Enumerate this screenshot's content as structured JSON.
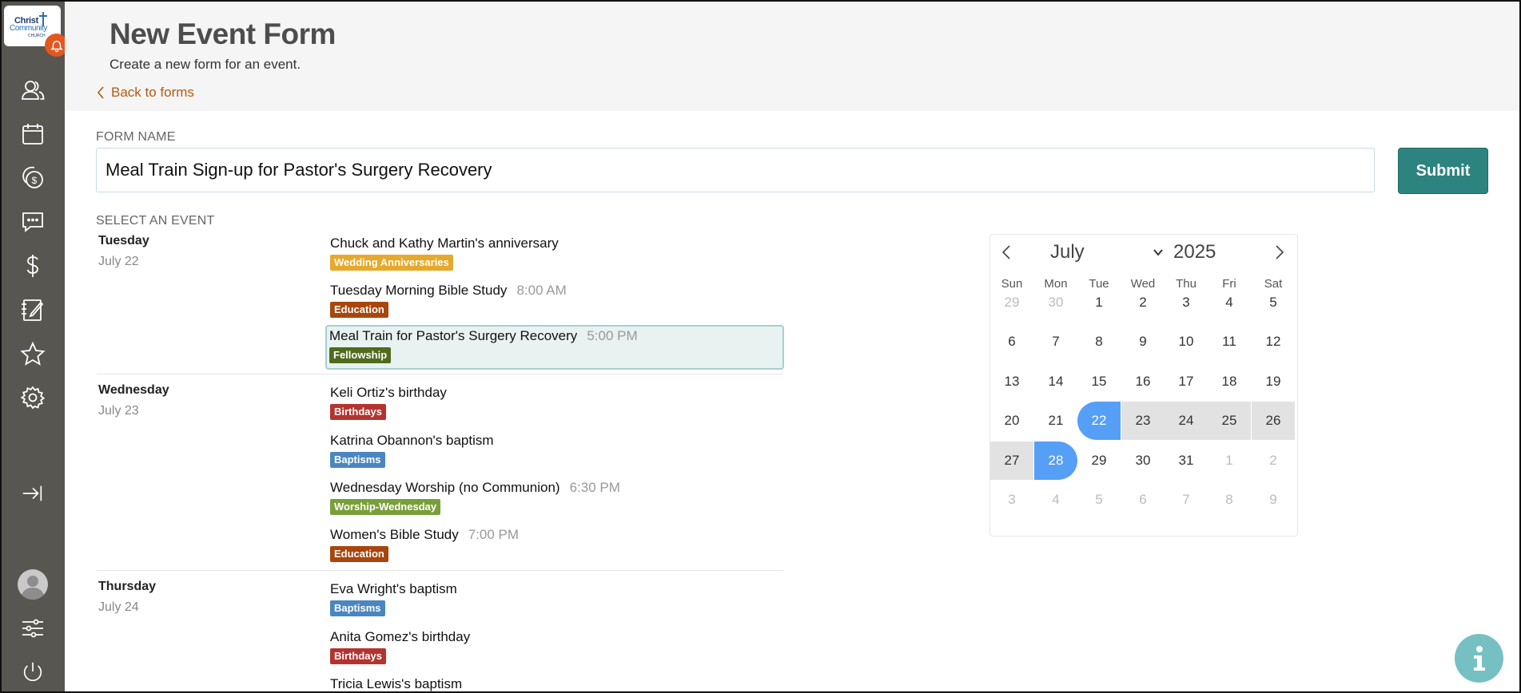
{
  "brand": {
    "logo_line1": "Christ",
    "logo_line2": "Community",
    "logo_line3": "CHURCH"
  },
  "header": {
    "title": "New Event Form",
    "subtitle": "Create a new form for an event.",
    "back_label": "Back to forms"
  },
  "form": {
    "name_label": "FORM NAME",
    "name_value": "Meal Train Sign-up for Pastor's Surgery Recovery",
    "submit_label": "Submit",
    "select_event_label": "SELECT AN EVENT"
  },
  "days": [
    {
      "day": "Tuesday",
      "date": "July 22",
      "events": [
        {
          "title": "Chuck and Kathy Martin's anniversary",
          "time": "",
          "tag": "Wedding Anniversaries",
          "tag_color": "#e5a92b"
        },
        {
          "title": "Tuesday Morning Bible Study",
          "time": "8:00 AM",
          "tag": "Education",
          "tag_color": "#a8460c"
        },
        {
          "title": "Meal Train for Pastor's Surgery Recovery",
          "time": "5:00 PM",
          "tag": "Fellowship",
          "tag_color": "#4f6b1c",
          "selected": true
        }
      ]
    },
    {
      "day": "Wednesday",
      "date": "July 23",
      "events": [
        {
          "title": "Keli Ortiz's birthday",
          "time": "",
          "tag": "Birthdays",
          "tag_color": "#b5332e"
        },
        {
          "title": "Katrina Obannon's baptism",
          "time": "",
          "tag": "Baptisms",
          "tag_color": "#4a86c0"
        },
        {
          "title": "Wednesday Worship (no Communion)",
          "time": "6:30 PM",
          "tag": "Worship-Wednesday",
          "tag_color": "#7a9f3a"
        },
        {
          "title": "Women's Bible Study",
          "time": "7:00 PM",
          "tag": "Education",
          "tag_color": "#a8460c"
        }
      ]
    },
    {
      "day": "Thursday",
      "date": "July 24",
      "events": [
        {
          "title": "Eva Wright's baptism",
          "time": "",
          "tag": "Baptisms",
          "tag_color": "#4a86c0"
        },
        {
          "title": "Anita Gomez's birthday",
          "time": "",
          "tag": "Birthdays",
          "tag_color": "#b5332e"
        },
        {
          "title": "Tricia Lewis's baptism",
          "time": "",
          "tag": "",
          "tag_color": ""
        }
      ]
    }
  ],
  "calendar": {
    "month": "July",
    "year": "2025",
    "weekdays": [
      "Sun",
      "Mon",
      "Tue",
      "Wed",
      "Thu",
      "Fri",
      "Sat"
    ],
    "weeks": [
      [
        "29",
        "30",
        "1",
        "2",
        "3",
        "4",
        "5"
      ],
      [
        "6",
        "7",
        "8",
        "9",
        "10",
        "11",
        "12"
      ],
      [
        "13",
        "14",
        "15",
        "16",
        "17",
        "18",
        "19"
      ],
      [
        "20",
        "21",
        "22",
        "23",
        "24",
        "25",
        "26"
      ],
      [
        "27",
        "28",
        "29",
        "30",
        "31",
        "1",
        "2"
      ],
      [
        "3",
        "4",
        "5",
        "6",
        "7",
        "8",
        "9"
      ]
    ],
    "muted_first_row_count": 2,
    "muted_after_day": 31,
    "range_start": "22",
    "range_end": "28",
    "selected_color": "#569ff7"
  },
  "sidebar": {
    "icons": [
      "people-icon",
      "calendar-icon",
      "giving-icon",
      "messages-icon",
      "dollar-icon",
      "notes-icon",
      "star-icon",
      "settings-icon",
      "collapse-icon",
      "avatar",
      "filters-icon",
      "power-icon"
    ]
  }
}
